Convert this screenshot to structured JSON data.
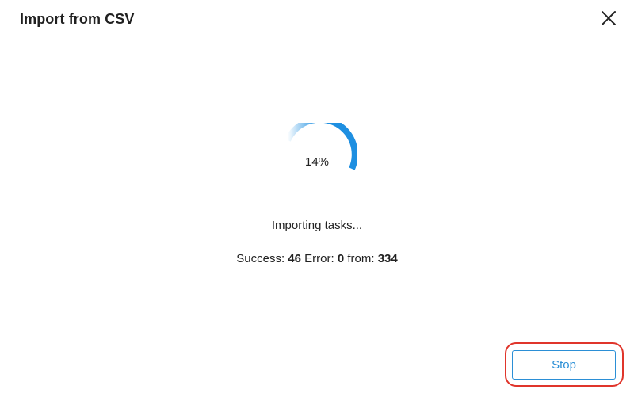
{
  "dialog": {
    "title": "Import from CSV",
    "close_icon": "close-icon"
  },
  "progress": {
    "percent": 14,
    "label": "14%",
    "color": "#1e8fe1"
  },
  "status": {
    "message": "Importing tasks...",
    "success_label": "Success:",
    "success_count": "46",
    "error_label": "Error:",
    "error_count": "0",
    "from_label": "from:",
    "total_count": "334"
  },
  "actions": {
    "stop_label": "Stop",
    "highlight_color": "#e0352b"
  }
}
